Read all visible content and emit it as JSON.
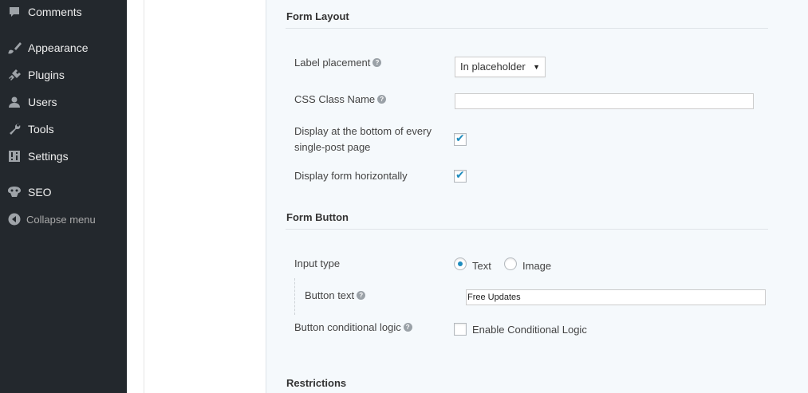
{
  "sidebar": {
    "items": [
      {
        "label": "Comments",
        "icon": "comment-icon"
      },
      {
        "label": "Appearance",
        "icon": "paintbrush-icon"
      },
      {
        "label": "Plugins",
        "icon": "plugin-icon"
      },
      {
        "label": "Users",
        "icon": "user-icon"
      },
      {
        "label": "Tools",
        "icon": "wrench-icon"
      },
      {
        "label": "Settings",
        "icon": "settings-icon"
      },
      {
        "label": "SEO",
        "icon": "seo-icon"
      }
    ],
    "collapse_label": "Collapse menu"
  },
  "form_layout": {
    "title": "Form Layout",
    "label_placement": {
      "label": "Label placement",
      "value": "In placeholder"
    },
    "css_class": {
      "label": "CSS Class Name",
      "value": ""
    },
    "display_bottom": {
      "label_line1": "Display at the bottom of every",
      "label_line2": "single-post page",
      "checked": true
    },
    "display_horizontal": {
      "label": "Display form horizontally",
      "checked": true
    }
  },
  "form_button": {
    "title": "Form Button",
    "input_type": {
      "label": "Input type",
      "options": [
        "Text",
        "Image"
      ],
      "selected": "Text"
    },
    "button_text": {
      "label": "Button text",
      "value": "Free Updates"
    },
    "conditional": {
      "label": "Button conditional logic",
      "option_label": "Enable Conditional Logic",
      "checked": false
    }
  },
  "restrictions": {
    "title": "Restrictions"
  },
  "help_glyph": "?",
  "check_glyph": "✔",
  "caret_glyph": "▼",
  "colors": {
    "sidebar_bg": "#23282d",
    "accent": "#1e8cbe",
    "content_bg": "#f5f9fc"
  }
}
